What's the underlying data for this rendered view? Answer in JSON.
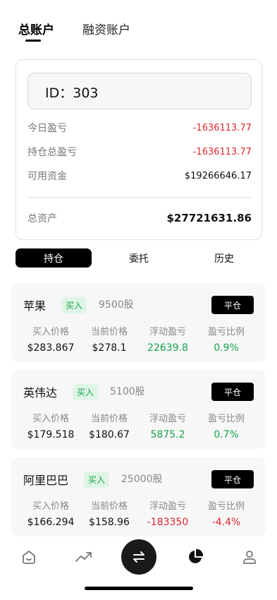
{
  "tabs": [
    {
      "label": "总账户",
      "active": true
    },
    {
      "label": "融资账户",
      "active": false
    }
  ],
  "account": {
    "id_text": "ID：303",
    "today_pnl_label": "今日盈亏",
    "today_pnl_value": "-1636113.77",
    "holding_pnl_label": "持仓总盈亏",
    "holding_pnl_value": "-1636113.77",
    "available_label": "可用资金",
    "available_value": "$19266646.17",
    "total_label": "总资产",
    "total_value": "$27721631.86"
  },
  "segments": [
    {
      "label": "持仓",
      "active": true
    },
    {
      "label": "委托",
      "active": false
    },
    {
      "label": "历史",
      "active": false
    }
  ],
  "columns": [
    "买入价格",
    "当前价格",
    "浮动盈亏",
    "盈亏比例"
  ],
  "close_label": "平仓",
  "positions": [
    {
      "name": "苹果",
      "side": "买入",
      "shares": "9500股",
      "buy_price": "$283.867",
      "cur_price": "$278.1",
      "float_pnl": "22639.8",
      "ratio": "0.9%",
      "positive": true
    },
    {
      "name": "英伟达",
      "side": "买入",
      "shares": "5100股",
      "buy_price": "$179.518",
      "cur_price": "$180.67",
      "float_pnl": "5875.2",
      "ratio": "0.7%",
      "positive": true
    },
    {
      "name": "阿里巴巴",
      "side": "买入",
      "shares": "25000股",
      "buy_price": "$166.294",
      "cur_price": "$158.96",
      "float_pnl": "-183350",
      "ratio": "-4.4%",
      "positive": false
    }
  ],
  "nav": [
    "home-icon",
    "trend-icon",
    "swap-icon",
    "pie-chart-icon",
    "user-icon"
  ],
  "colors": {
    "red": "#e0282d",
    "green": "#16a34a",
    "badge_bg": "#dff5e6"
  }
}
